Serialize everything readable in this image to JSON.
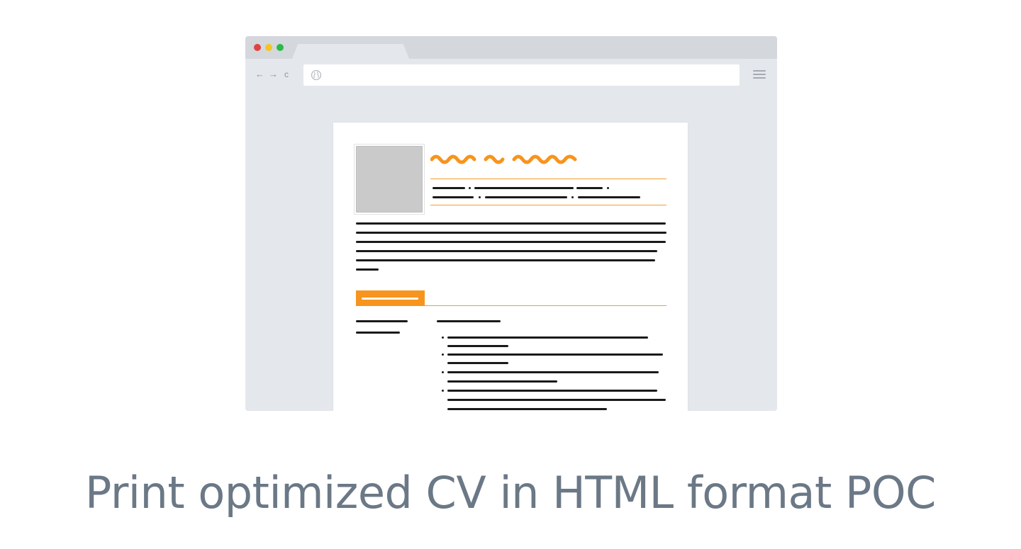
{
  "browser": {
    "window_controls": [
      "close",
      "minimize",
      "maximize"
    ],
    "nav": {
      "back_icon": "←",
      "forward_icon": "→",
      "reload_icon": "c"
    },
    "address_bar": {
      "icon": "globe-icon",
      "value": ""
    },
    "menu_icon": "hamburger-menu-icon"
  },
  "document": {
    "accent_color": "#f7941d",
    "photo_placeholder": "photo-placeholder",
    "print_icon": "printer-icon"
  },
  "caption": "Print optimized CV in HTML format POC"
}
